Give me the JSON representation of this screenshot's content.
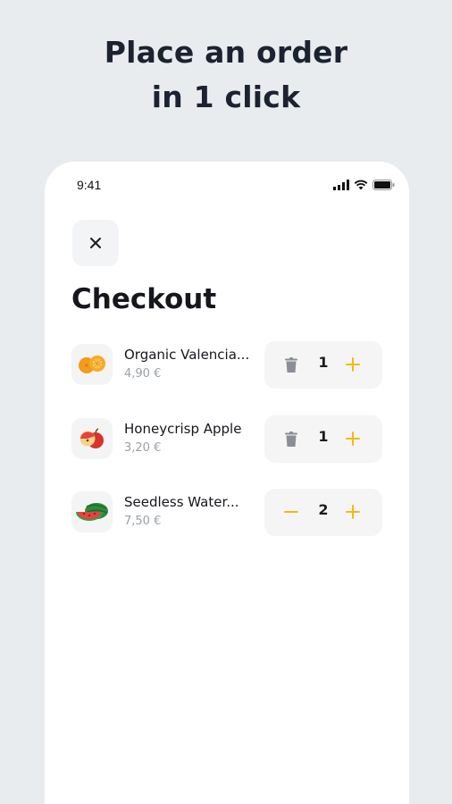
{
  "headline": {
    "line1": "Place an order",
    "line2": "in 1 click"
  },
  "status_bar": {
    "time": "9:41",
    "icons": [
      "signal-icon",
      "wifi-icon",
      "battery-icon"
    ]
  },
  "checkout": {
    "close_icon": "close-icon",
    "title": "Checkout",
    "items": [
      {
        "name": "Organic Valencia...",
        "price": "4,90 €",
        "quantity": "1",
        "left_action": "trash-icon",
        "thumbnail": "oranges-icon"
      },
      {
        "name": "Honeycrisp Apple",
        "price": "3,20 €",
        "quantity": "1",
        "left_action": "trash-icon",
        "thumbnail": "apples-icon"
      },
      {
        "name": "Seedless Water...",
        "price": "7,50 €",
        "quantity": "2",
        "left_action": "minus-icon",
        "thumbnail": "watermelon-icon"
      }
    ]
  },
  "colors": {
    "accent": "#f5b90f",
    "background": "#e9ecef",
    "card": "#ffffff",
    "muted_text": "#9aa0a6"
  }
}
